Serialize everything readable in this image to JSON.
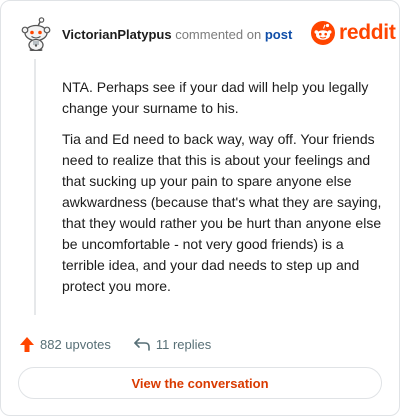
{
  "comment": {
    "author": "VictorianPlatypus",
    "action_text": "commented on",
    "target_link": "post",
    "paragraphs": [
      "NTA. Perhaps see if your dad will help you legally change your surname to his.",
      "Tia and Ed need to back way, way off. Your friends need to realize that this is about your feelings and that sucking up your pain to spare anyone else awkwardness (because that's what they are saying, that they would rather you be hurt than anyone else be uncomfortable - not very good friends) is a terrible idea, and your dad needs to step up and protect you more."
    ]
  },
  "brand": {
    "name": "reddit",
    "icon": "reddit-snoo-icon",
    "color": "#ff4500"
  },
  "stats": {
    "upvotes": "882 upvotes",
    "replies": "11 replies",
    "upvote_icon": "upvote-arrow-icon",
    "reply_icon": "reply-arrow-icon",
    "upvote_color": "#ff4500"
  },
  "cta": {
    "label": "View the conversation",
    "color": "#d93a00"
  },
  "avatar": {
    "icon": "snoo-avatar-icon"
  }
}
